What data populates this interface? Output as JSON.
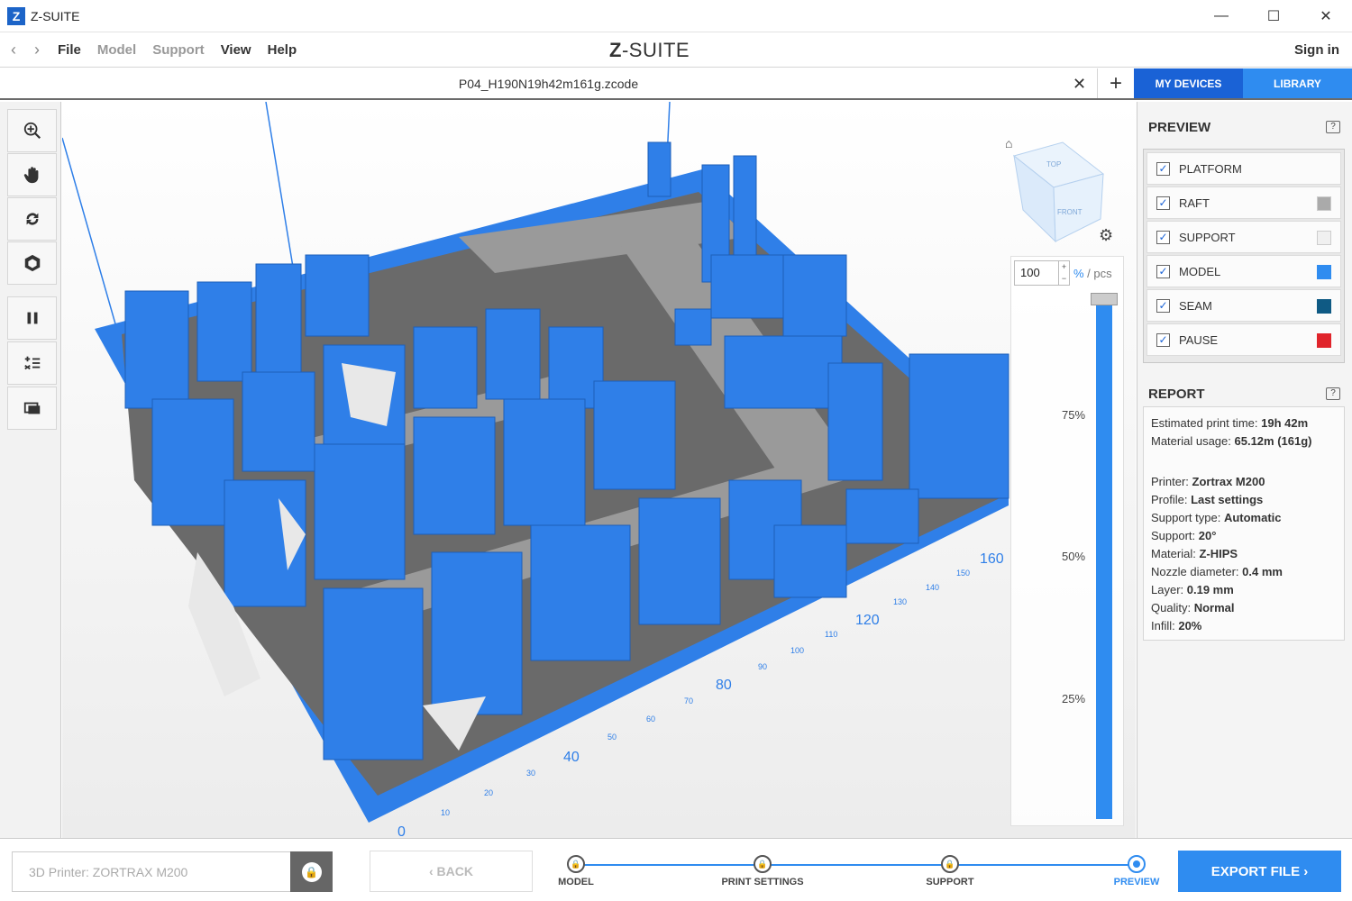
{
  "window": {
    "title": "Z-SUITE",
    "logo_letter": "Z",
    "minimize": "—",
    "maximize": "☐",
    "close": "✕"
  },
  "menu": {
    "back": "‹",
    "forward": "›",
    "items": [
      "File",
      "Model",
      "Support",
      "View",
      "Help"
    ],
    "brand_mark": "Z",
    "brand_text": "-SUITE",
    "sign_in": "Sign in"
  },
  "tabs": {
    "file_name": "P04_H190N19h42m161g.zcode",
    "close": "✕",
    "add": "+",
    "my_devices": "MY DEVICES",
    "library": "LIBRARY"
  },
  "toolbar": {
    "icons": [
      "zoom-icon",
      "pan-hand-icon",
      "rotate-icon",
      "view-cube-icon",
      "pause-icon",
      "layer-steps-icon",
      "layer-view-icon"
    ]
  },
  "viewport": {
    "home_glyph": "⌂",
    "gear_glyph": "⚙",
    "cube_top": "TOP",
    "cube_front": "FRONT",
    "axis_labels": [
      "0",
      "10",
      "20",
      "30",
      "40",
      "50",
      "60",
      "70",
      "80",
      "90",
      "100",
      "110",
      "120",
      "130",
      "140",
      "150",
      "160"
    ],
    "model_color": "#2f7fe8"
  },
  "slider": {
    "value": "100",
    "spin_up": "+",
    "spin_down": "−",
    "unit_pct": "%",
    "unit_rest": " / pcs",
    "ticks": [
      "75%",
      "50%",
      "25%"
    ],
    "level": 1.0
  },
  "preview": {
    "title": "PREVIEW",
    "help": "?",
    "layers": [
      {
        "label": "PLATFORM",
        "checked": true,
        "color": ""
      },
      {
        "label": "RAFT",
        "checked": true,
        "color": "#aaaaaa"
      },
      {
        "label": "SUPPORT",
        "checked": true,
        "color": "#f0f0f0"
      },
      {
        "label": "MODEL",
        "checked": true,
        "color": "#2f8cf0"
      },
      {
        "label": "SEAM",
        "checked": true,
        "color": "#0f5a84"
      },
      {
        "label": "PAUSE",
        "checked": true,
        "color": "#e0242b"
      }
    ]
  },
  "report": {
    "title": "REPORT",
    "help": "?",
    "lines_top": [
      {
        "k": "Estimated print time: ",
        "v": "19h 42m"
      },
      {
        "k": "Material usage: ",
        "v": "65.12m (161g)"
      }
    ],
    "lines_bottom": [
      {
        "k": "Printer: ",
        "v": "Zortrax M200"
      },
      {
        "k": "Profile: ",
        "v": "Last settings"
      },
      {
        "k": "Support type: ",
        "v": "Automatic"
      },
      {
        "k": "Support: ",
        "v": "20°"
      },
      {
        "k": "Material: ",
        "v": "Z-HIPS"
      },
      {
        "k": "Nozzle diameter: ",
        "v": "0.4 mm"
      },
      {
        "k": "Layer: ",
        "v": "0.19 mm"
      },
      {
        "k": "Quality: ",
        "v": "Normal"
      },
      {
        "k": "Infill: ",
        "v": "20%"
      }
    ]
  },
  "bottom": {
    "printer_placeholder": "3D Printer: ZORTRAX M200",
    "lock_glyph": "🔒",
    "back_label": "‹  BACK",
    "steps": [
      {
        "label": "MODEL",
        "active": false
      },
      {
        "label": "PRINT SETTINGS",
        "active": false
      },
      {
        "label": "SUPPORT",
        "active": false
      },
      {
        "label": "PREVIEW",
        "active": true
      }
    ],
    "export_label": "EXPORT FILE  ›"
  },
  "colors": {
    "accent": "#2f8cf0",
    "accent_dark": "#1a62d6"
  }
}
